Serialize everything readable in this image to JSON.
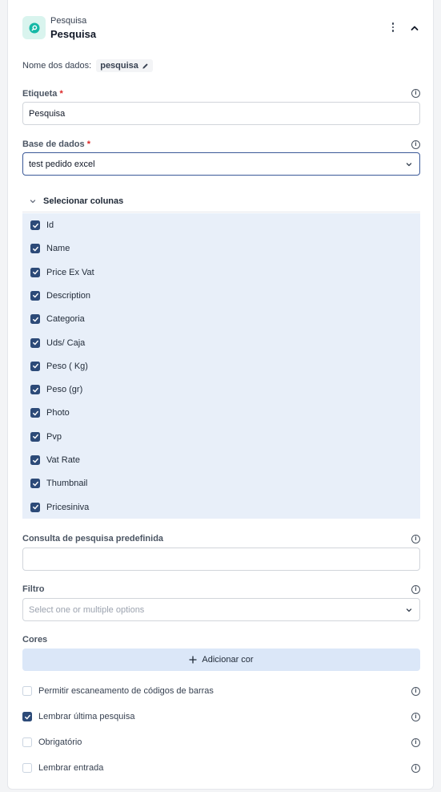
{
  "header": {
    "subtitle": "Pesquisa",
    "title": "Pesquisa"
  },
  "data_name": {
    "label": "Nome dos dados:",
    "value": "pesquisa"
  },
  "fields": {
    "etiqueta": {
      "label": "Etiqueta",
      "required_mark": "*",
      "value": "Pesquisa"
    },
    "base": {
      "label": "Base de dados",
      "required_mark": "*",
      "value": "test pedido excel"
    },
    "consulta": {
      "label": "Consulta de pesquisa predefinida",
      "value": ""
    },
    "filtro": {
      "label": "Filtro",
      "placeholder": "Select one or multiple options"
    },
    "cores": {
      "label": "Cores",
      "add_label": "Adicionar cor"
    }
  },
  "columns": {
    "title": "Selecionar colunas",
    "items": [
      {
        "label": "Id",
        "checked": true
      },
      {
        "label": "Name",
        "checked": true
      },
      {
        "label": "Price Ex Vat",
        "checked": true
      },
      {
        "label": "Description",
        "checked": true
      },
      {
        "label": "Categoria",
        "checked": true
      },
      {
        "label": "Uds/ Caja",
        "checked": true
      },
      {
        "label": "Peso ( Kg)",
        "checked": true
      },
      {
        "label": "Peso (gr)",
        "checked": true
      },
      {
        "label": "Photo",
        "checked": true
      },
      {
        "label": "Pvp",
        "checked": true
      },
      {
        "label": "Vat Rate",
        "checked": true
      },
      {
        "label": "Thumbnail",
        "checked": true
      },
      {
        "label": "Pricesiniva",
        "checked": true
      }
    ]
  },
  "options": [
    {
      "label": "Permitir escaneamento de códigos de barras",
      "checked": false
    },
    {
      "label": "Lembrar última pesquisa",
      "checked": true
    },
    {
      "label": "Obrigatório",
      "checked": false
    },
    {
      "label": "Lembrar entrada",
      "checked": false
    }
  ],
  "colors": {
    "accent": "#2c4a78",
    "selection_bg": "#e8eff9",
    "button_bg": "#dbe7f8",
    "required": "#dc2626",
    "icon_teal": "#14b8a6"
  },
  "icons": [
    "search-icon",
    "kebab-menu-icon",
    "chevron-up-icon",
    "pencil-icon",
    "info-icon",
    "chevron-down-icon",
    "plus-icon",
    "check-icon"
  ]
}
